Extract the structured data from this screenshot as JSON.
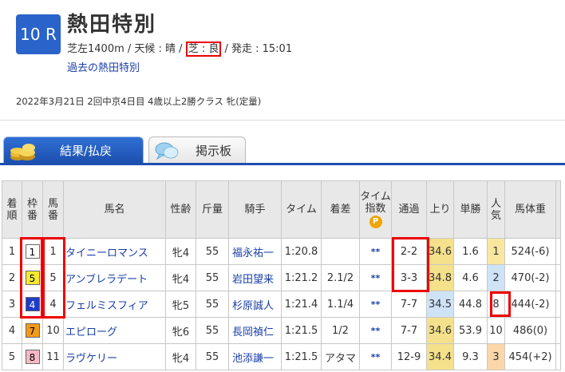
{
  "race": {
    "number": "10 R",
    "name": "熱田特別",
    "info_pre": "芝左1400m / 天候 : 晴 / ",
    "track_condition": "芝 : 良",
    "info_post": " / 発走 : 15:01",
    "past_link": "過去の熱田特別",
    "meta": "2022年3月21日 2回中京4日目 4歳以上2勝クラス  牝(定量)"
  },
  "tabs": [
    {
      "label": "結果/払戻",
      "icon": "coins-icon"
    },
    {
      "label": "掲示板",
      "icon": "speech-bubble-icon"
    }
  ],
  "table": {
    "headers": {
      "rank": "着順",
      "waku": "枠番",
      "umaban": "馬番",
      "horse": "馬名",
      "sexage": "性齢",
      "weight": "斤量",
      "jockey": "騎手",
      "time": "タイム",
      "margin": "着差",
      "index": "タイム指数",
      "index_badge": "P",
      "passing": "通過",
      "agari": "上り",
      "odds": "単勝",
      "pop": "人気",
      "body": "馬体重"
    },
    "rows": [
      {
        "rank": "1",
        "waku": "1",
        "umaban": "1",
        "horse": "タイニーロマンス",
        "sexage": "牝4",
        "weight": "55",
        "jockey": "福永祐一",
        "time": "1:20.8",
        "margin": "",
        "index": "**",
        "passing": "2-2",
        "agari": "34.6",
        "odds": "1.6",
        "pop": "1",
        "body": "524(-6)"
      },
      {
        "rank": "2",
        "waku": "5",
        "umaban": "5",
        "horse": "アンブレラデート",
        "sexage": "牝4",
        "weight": "55",
        "jockey": "岩田望来",
        "time": "1:21.2",
        "margin": "2.1/2",
        "index": "**",
        "passing": "3-3",
        "agari": "34.8",
        "odds": "4.6",
        "pop": "2",
        "body": "470(-2)"
      },
      {
        "rank": "3",
        "waku": "4",
        "umaban": "4",
        "horse": "フェルミスフィア",
        "sexage": "牝5",
        "weight": "55",
        "jockey": "杉原誠人",
        "time": "1:21.4",
        "margin": "1.1/4",
        "index": "**",
        "passing": "7-7",
        "agari": "34.5",
        "odds": "44.8",
        "pop": "8",
        "body": "444(-2)"
      },
      {
        "rank": "4",
        "waku": "7",
        "umaban": "10",
        "horse": "エピローグ",
        "sexage": "牝6",
        "weight": "55",
        "jockey": "長岡禎仁",
        "time": "1:21.5",
        "margin": "1/2",
        "index": "**",
        "passing": "7-7",
        "agari": "34.6",
        "odds": "53.9",
        "pop": "10",
        "body": "486(0)"
      },
      {
        "rank": "5",
        "waku": "8",
        "umaban": "11",
        "horse": "ラヴケリー",
        "sexage": "牝4",
        "weight": "55",
        "jockey": "池添謙一",
        "time": "1:21.5",
        "margin": "アタマ",
        "index": "**",
        "passing": "12-9",
        "agari": "34.4",
        "odds": "9.3",
        "pop": "3",
        "body": "454(+2)"
      }
    ]
  }
}
